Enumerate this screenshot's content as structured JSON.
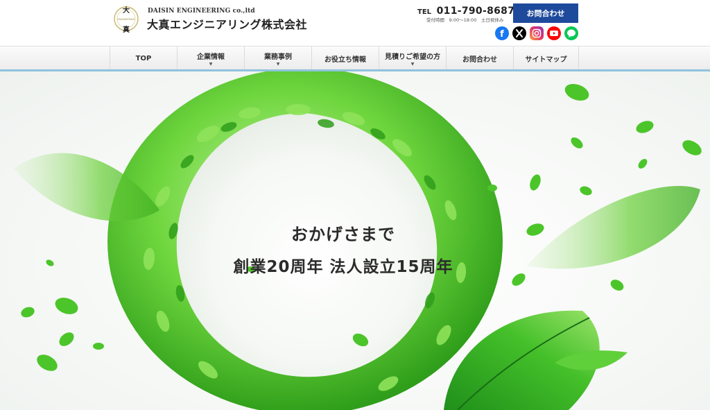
{
  "header": {
    "logo_top_char": "大",
    "logo_bottom_char": "真",
    "logo_ring_text": "ENGINEERING",
    "company_en": "DAISIN ENGINEERING co.,ltd",
    "company_ja": "大真エンジニアリング株式会社",
    "tel_label": "TEL",
    "tel_number": "011-790-8687",
    "hours": "受付時間　9:00～18:00　土日祝休み",
    "contact_label": "お問合わせ"
  },
  "social": [
    {
      "name": "facebook",
      "icon": "facebook-icon",
      "color": "#1877f2",
      "glyph": "f"
    },
    {
      "name": "x",
      "icon": "x-icon",
      "color": "#000000",
      "glyph": "𝕏"
    },
    {
      "name": "instagram",
      "icon": "instagram-icon",
      "color": "#e1306c",
      "glyph": "◎"
    },
    {
      "name": "youtube",
      "icon": "youtube-icon",
      "color": "#ff0000",
      "glyph": "▶"
    },
    {
      "name": "line",
      "icon": "line-icon",
      "color": "#06c755",
      "glyph": "L"
    }
  ],
  "nav": {
    "items": [
      {
        "label": "TOP",
        "has_dropdown": false
      },
      {
        "label": "企業情報",
        "has_dropdown": true
      },
      {
        "label": "業務事例",
        "has_dropdown": true
      },
      {
        "label": "お役立ち情報",
        "has_dropdown": false
      },
      {
        "label": "見積りご希望の方",
        "has_dropdown": true
      },
      {
        "label": "お問合わせ",
        "has_dropdown": false
      },
      {
        "label": "サイトマップ",
        "has_dropdown": false
      }
    ],
    "caret": "▼"
  },
  "hero": {
    "line1": "おかげさまで",
    "line2": "創業20周年 法人設立15周年"
  },
  "colors": {
    "brand_blue": "#1e4a9c",
    "nav_accent": "#8fc3de",
    "leaf_green": "#4cc52a"
  }
}
